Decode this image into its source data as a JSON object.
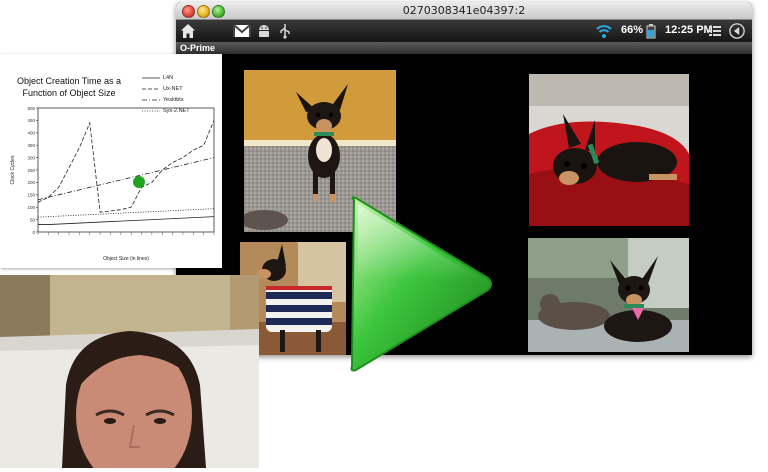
{
  "window": {
    "title": "0270308341e04397:2"
  },
  "status_bar": {
    "home_icon": "home-icon",
    "notification_icons": [
      "gmail-icon",
      "android-debug-icon",
      "usb-icon"
    ],
    "wifi_icon": "wifi-icon",
    "battery_percent": "66%",
    "battery_icon": "battery-icon",
    "time": "12:25 PM",
    "menu_icon": "menu-list-icon",
    "back_icon": "back-icon"
  },
  "app_bar": {
    "title": "O-Prime"
  },
  "gallery": {
    "photos": [
      {
        "subject": "chihuahua-standing"
      },
      {
        "subject": "chihuahua-lying-on-red-cushion"
      },
      {
        "subject": "chihuahua-in-striped-sweater"
      },
      {
        "subject": "chihuahua-with-cat"
      }
    ]
  },
  "chart_panel": {
    "title_line1": "Object Creation Time as a",
    "title_line2": "Function of Object Size",
    "legend": [
      "L4N",
      "Ux-NET",
      "Yesktbtx",
      "Sys-2.NET"
    ]
  },
  "chart_data": {
    "type": "line",
    "title": "Object Creation Time as a Function of Object Size",
    "xlabel": "Object Size (in lines)",
    "ylabel": "Clock Cycles",
    "y_ticks": [
      "500",
      "450",
      "400",
      "350",
      "300",
      "250",
      "200",
      "150",
      "100",
      "50",
      "0"
    ],
    "x_count": 18,
    "ylim": [
      0,
      500
    ],
    "series": [
      {
        "name": "L4N",
        "style": "solid",
        "values": [
          30,
          30,
          32,
          34,
          36,
          38,
          40,
          42,
          44,
          46,
          48,
          50,
          52,
          54,
          56,
          58,
          60,
          62
        ]
      },
      {
        "name": "Ux-NET",
        "style": "dashed",
        "values": [
          120,
          140,
          180,
          260,
          340,
          440,
          80,
          85,
          90,
          100,
          180,
          200,
          250,
          280,
          300,
          330,
          350,
          450
        ]
      },
      {
        "name": "Yesktbtx",
        "style": "dash-dot",
        "values": [
          130,
          140,
          150,
          160,
          170,
          180,
          190,
          200,
          210,
          220,
          230,
          240,
          250,
          260,
          270,
          280,
          290,
          300
        ]
      },
      {
        "name": "Sys-2.NET",
        "style": "dotted",
        "values": [
          60,
          62,
          64,
          66,
          68,
          70,
          72,
          74,
          76,
          78,
          80,
          82,
          84,
          86,
          88,
          90,
          92,
          94
        ]
      }
    ],
    "marker_color": "#1fa31f",
    "grid": false
  },
  "overlay": {
    "play_icon": "play-icon",
    "accent": "#3cc43c"
  },
  "webcam": {
    "subject": "webcam-face"
  }
}
